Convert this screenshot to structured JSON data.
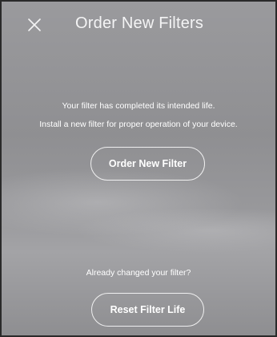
{
  "header": {
    "close_icon": "close-icon",
    "title": "Order New Filters"
  },
  "main": {
    "message_line1": "Your filter has completed its intended life.",
    "message_line2": "Install a new filter for proper operation of your device.",
    "order_button_label": "Order New Filter",
    "question": "Already changed your filter?",
    "reset_button_label": "Reset Filter Life"
  },
  "colors": {
    "background": "#949497",
    "text": "#ffffff",
    "button_border": "#ffffff"
  }
}
